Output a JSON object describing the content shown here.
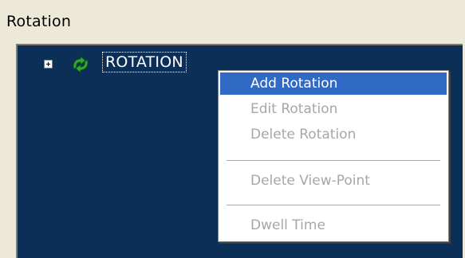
{
  "panel": {
    "title": "Rotation"
  },
  "tree": {
    "root_label": "ROTATION",
    "root_icon": "rotation-node-icon",
    "expand_icon": "plus-expander-icon"
  },
  "context_menu": {
    "items": [
      {
        "label": "Add Rotation",
        "enabled": true,
        "highlighted": true
      },
      {
        "label": "Edit Rotation",
        "enabled": false
      },
      {
        "label": "Delete Rotation",
        "enabled": false
      },
      {
        "label": "Delete View-Point",
        "enabled": false
      },
      {
        "label": "Dwell Time",
        "enabled": false
      }
    ]
  },
  "colors": {
    "window_bg": "#ece9d8",
    "tree_bg": "#0c2f57",
    "highlight": "#316ac5",
    "disabled_text": "#a7a7a7",
    "icon_green": "#2fa82f"
  }
}
